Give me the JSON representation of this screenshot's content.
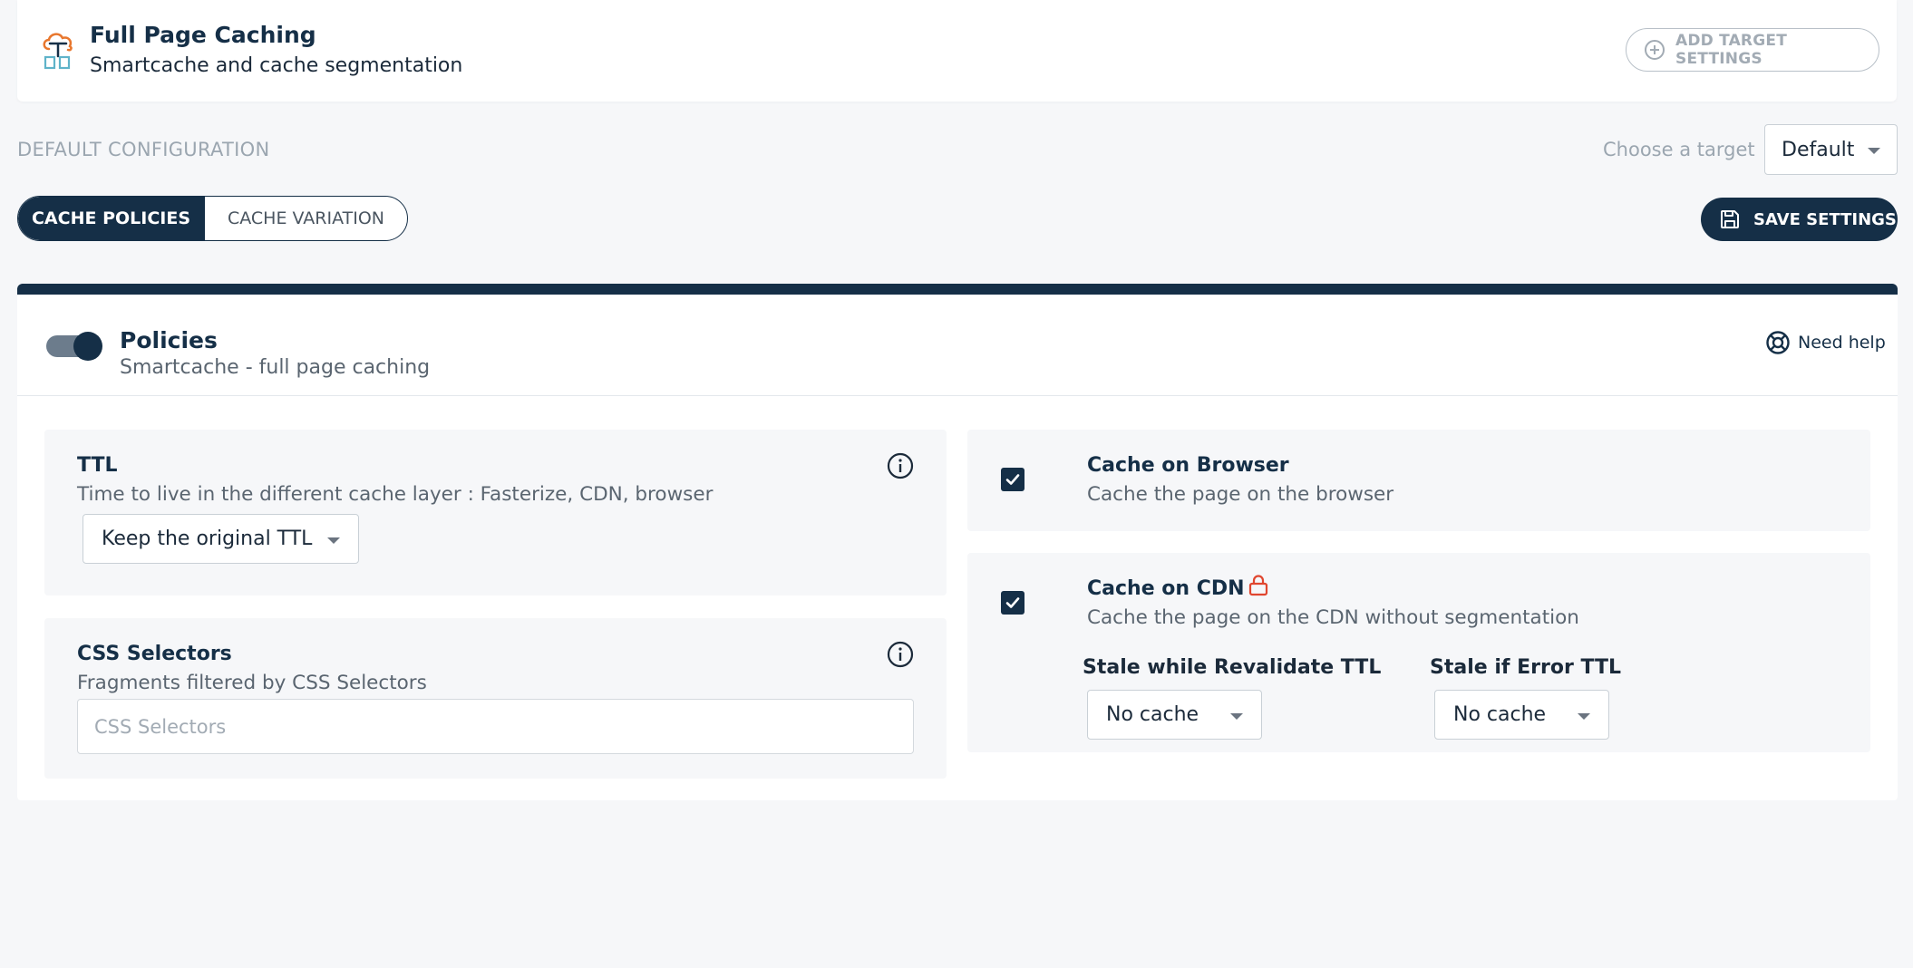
{
  "header": {
    "title": "Full Page Caching",
    "subtitle": "Smartcache and cache segmentation",
    "add_target_label": "ADD TARGET SETTINGS"
  },
  "config": {
    "section_title": "DEFAULT CONFIGURATION",
    "target_label": "Choose a target",
    "target_value": "Default"
  },
  "tabs": [
    {
      "label": "CACHE POLICIES",
      "active": true
    },
    {
      "label": "CACHE VARIATION",
      "active": false
    }
  ],
  "save_label": "SAVE SETTINGS",
  "policies": {
    "enabled": true,
    "title": "Policies",
    "subtitle": "Smartcache - full page caching",
    "help_label": "Need help"
  },
  "ttl": {
    "title": "TTL",
    "description": "Time to live in the different cache layer : Fasterize, CDN, browser",
    "value": "Keep the original TTL"
  },
  "css_selectors": {
    "title": "CSS Selectors",
    "description": "Fragments filtered by CSS Selectors",
    "placeholder": "CSS Selectors",
    "value": ""
  },
  "cache_browser": {
    "checked": true,
    "title": "Cache on Browser",
    "description": "Cache the page on the browser"
  },
  "cache_cdn": {
    "checked": true,
    "locked": true,
    "title": "Cache on CDN",
    "description": "Cache the page on the CDN without segmentation",
    "swr_label": "Stale while Revalidate TTL",
    "swr_value": "No cache",
    "sie_label": "Stale if Error TTL",
    "sie_value": "No cache"
  },
  "colors": {
    "primary": "#152f47",
    "background": "#f6f7f9",
    "muted": "#9ba6b0",
    "lock": "#e0462f",
    "logo_orange": "#e8772e",
    "logo_teal": "#5fb3c9"
  }
}
